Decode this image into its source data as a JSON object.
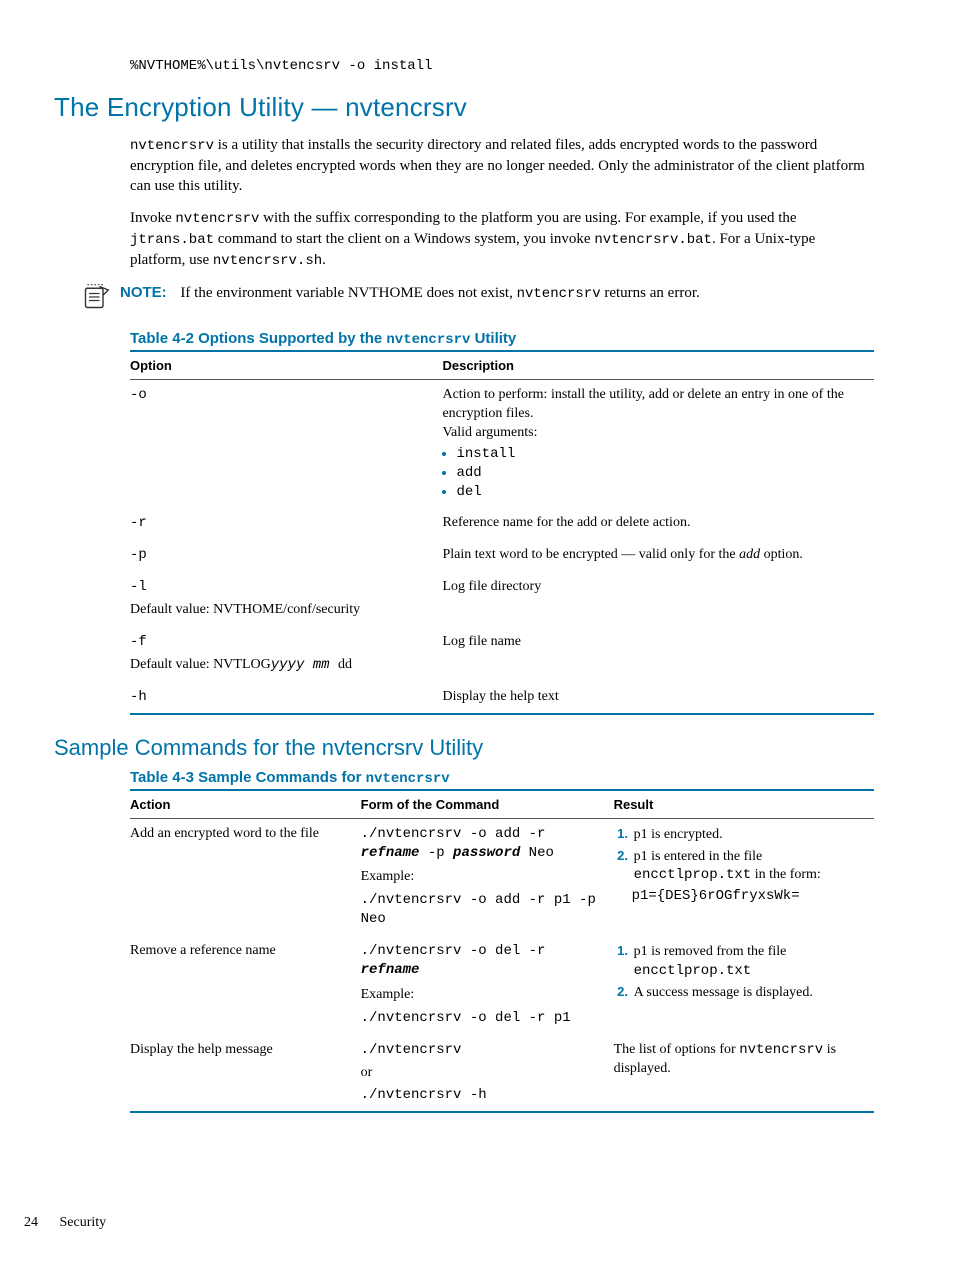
{
  "topCommand": "%NVTHOME%\\utils\\nvtencsrv -o install",
  "section1": {
    "title": "The Encryption Utility — nvtencrsrv",
    "p1_a": "nvtencrsrv",
    "p1_b": " is a utility that installs the security directory and related files, adds encrypted words to the password encryption file, and deletes encrypted words when they are no longer needed. Only the administrator of the client platform can use this utility.",
    "p2_a": "Invoke ",
    "p2_b": "nvtencrsrv",
    "p2_c": " with the suffix corresponding to the platform you are using. For example, if you used the ",
    "p2_d": "jtrans.bat",
    "p2_e": " command to start the client on a Windows system, you invoke ",
    "p2_f": "nvtencrsrv.bat",
    "p2_g": ". For a Unix-type platform, use ",
    "p2_h": "nvtencrsrv.sh",
    "p2_i": "."
  },
  "note": {
    "label": "NOTE:",
    "a": "If the environment variable NVTHOME does not exist, ",
    "b": "nvtencrsrv",
    "c": " returns an error."
  },
  "table1": {
    "caption_a": "Table 4-2 Options Supported by the ",
    "caption_b": "nvtencrsrv",
    "caption_c": " Utility",
    "h1": "Option",
    "h2": "Description",
    "rows": {
      "r0": {
        "opt": "-o",
        "desc_a": "Action to perform: install the utility, add or delete an entry in one of the encryption files.",
        "desc_b": "Valid arguments:",
        "arg1": "install",
        "arg2": "add",
        "arg3": "del"
      },
      "r1": {
        "opt": "-r",
        "desc": "Reference name for the add or delete action."
      },
      "r2": {
        "opt": "-p",
        "desc_a": "Plain text word to be encrypted — valid only for the ",
        "desc_b": "add",
        "desc_c": " option."
      },
      "r3": {
        "opt": "-l",
        "desc": "Log file directory",
        "def": "Default value: NVTHOME/conf/security"
      },
      "r4": {
        "opt": "-f",
        "desc": "Log file name",
        "def_a": "Default value: NVTLOG",
        "def_b": "yyyy mm ",
        "def_c": "dd"
      },
      "r5": {
        "opt": "-h",
        "desc": "Display the help text"
      }
    }
  },
  "section2": {
    "title": "Sample Commands for the nvtencrsrv Utility"
  },
  "table2": {
    "caption_a": "Table 4-3 Sample Commands for ",
    "caption_b": "nvtencrsrv",
    "h1": "Action",
    "h2": "Form of the Command",
    "h3": "Result",
    "rows": {
      "r0": {
        "action": "Add an encrypted word to the file",
        "form_a": "./nvtencrsrv -o add -r ",
        "form_b": "refname",
        "form_c": " -p ",
        "form_d": "password",
        "form_e": " Neo",
        "ex_label": "Example:",
        "ex_cmd": "./nvtencrsrv -o add -r p1 -p Neo",
        "res1": "p1 is encrypted.",
        "res2_a": "p1 is entered in the file ",
        "res2_b": "encctlprop.txt",
        "res2_c": " in the form:",
        "res3": "p1={DES}6rOGfryxsWk="
      },
      "r1": {
        "action": "Remove a reference name",
        "form_a": "./nvtencrsrv -o del -r ",
        "form_b": "refname",
        "ex_label": "Example:",
        "ex_cmd": "./nvtencrsrv -o del -r p1",
        "res1_a": "p1 is removed from the file ",
        "res1_b": "encctlprop.txt",
        "res2": "A success message is displayed."
      },
      "r2": {
        "action": "Display the help message",
        "form_a": "./nvtencrsrv",
        "form_b": "or",
        "form_c": "./nvtencrsrv -h",
        "res_a": "The list of options for ",
        "res_b": "nvtencrsrv",
        "res_c": " is displayed."
      }
    }
  },
  "footer": {
    "page": "24",
    "section": "Security"
  }
}
